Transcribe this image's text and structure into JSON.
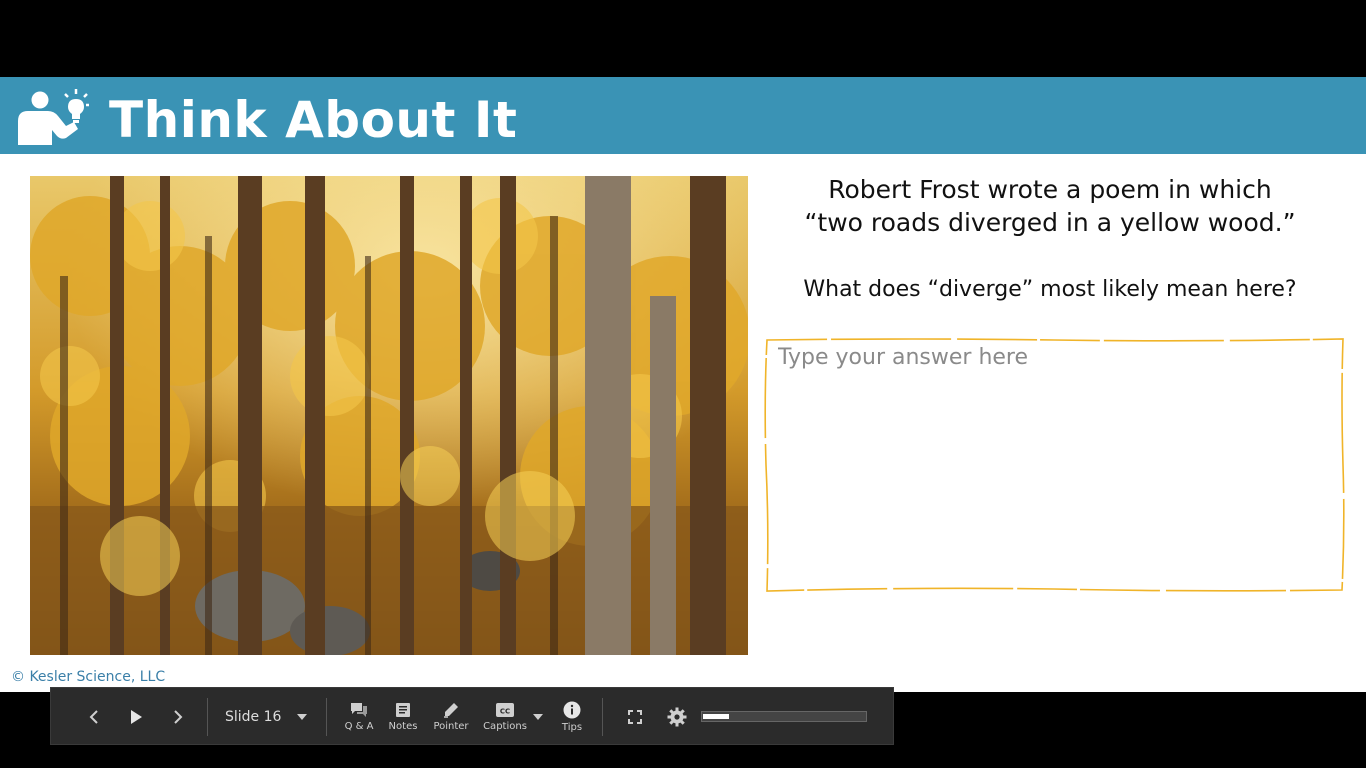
{
  "slide": {
    "title": "Think About It",
    "prompt_line1": "Robert Frost wrote a poem in which",
    "prompt_line2": "“two roads diverged in a yellow wood.”",
    "question": "What does “diverge” most likely mean here?",
    "answer_placeholder": "Type your answer here",
    "answer_value": "",
    "copyright": "© Kesler Science, LLC",
    "accent_color": "#3a93b5",
    "answer_border_color": "#f0b429"
  },
  "player": {
    "prev_icon": "chevron-left-icon",
    "play_icon": "play-icon",
    "next_icon": "chevron-right-icon",
    "slide_label": "Slide 16",
    "qa_label": "Q & A",
    "notes_label": "Notes",
    "pointer_label": "Pointer",
    "captions_label": "Captions",
    "tips_label": "Tips",
    "progress_fraction": 0.16
  }
}
